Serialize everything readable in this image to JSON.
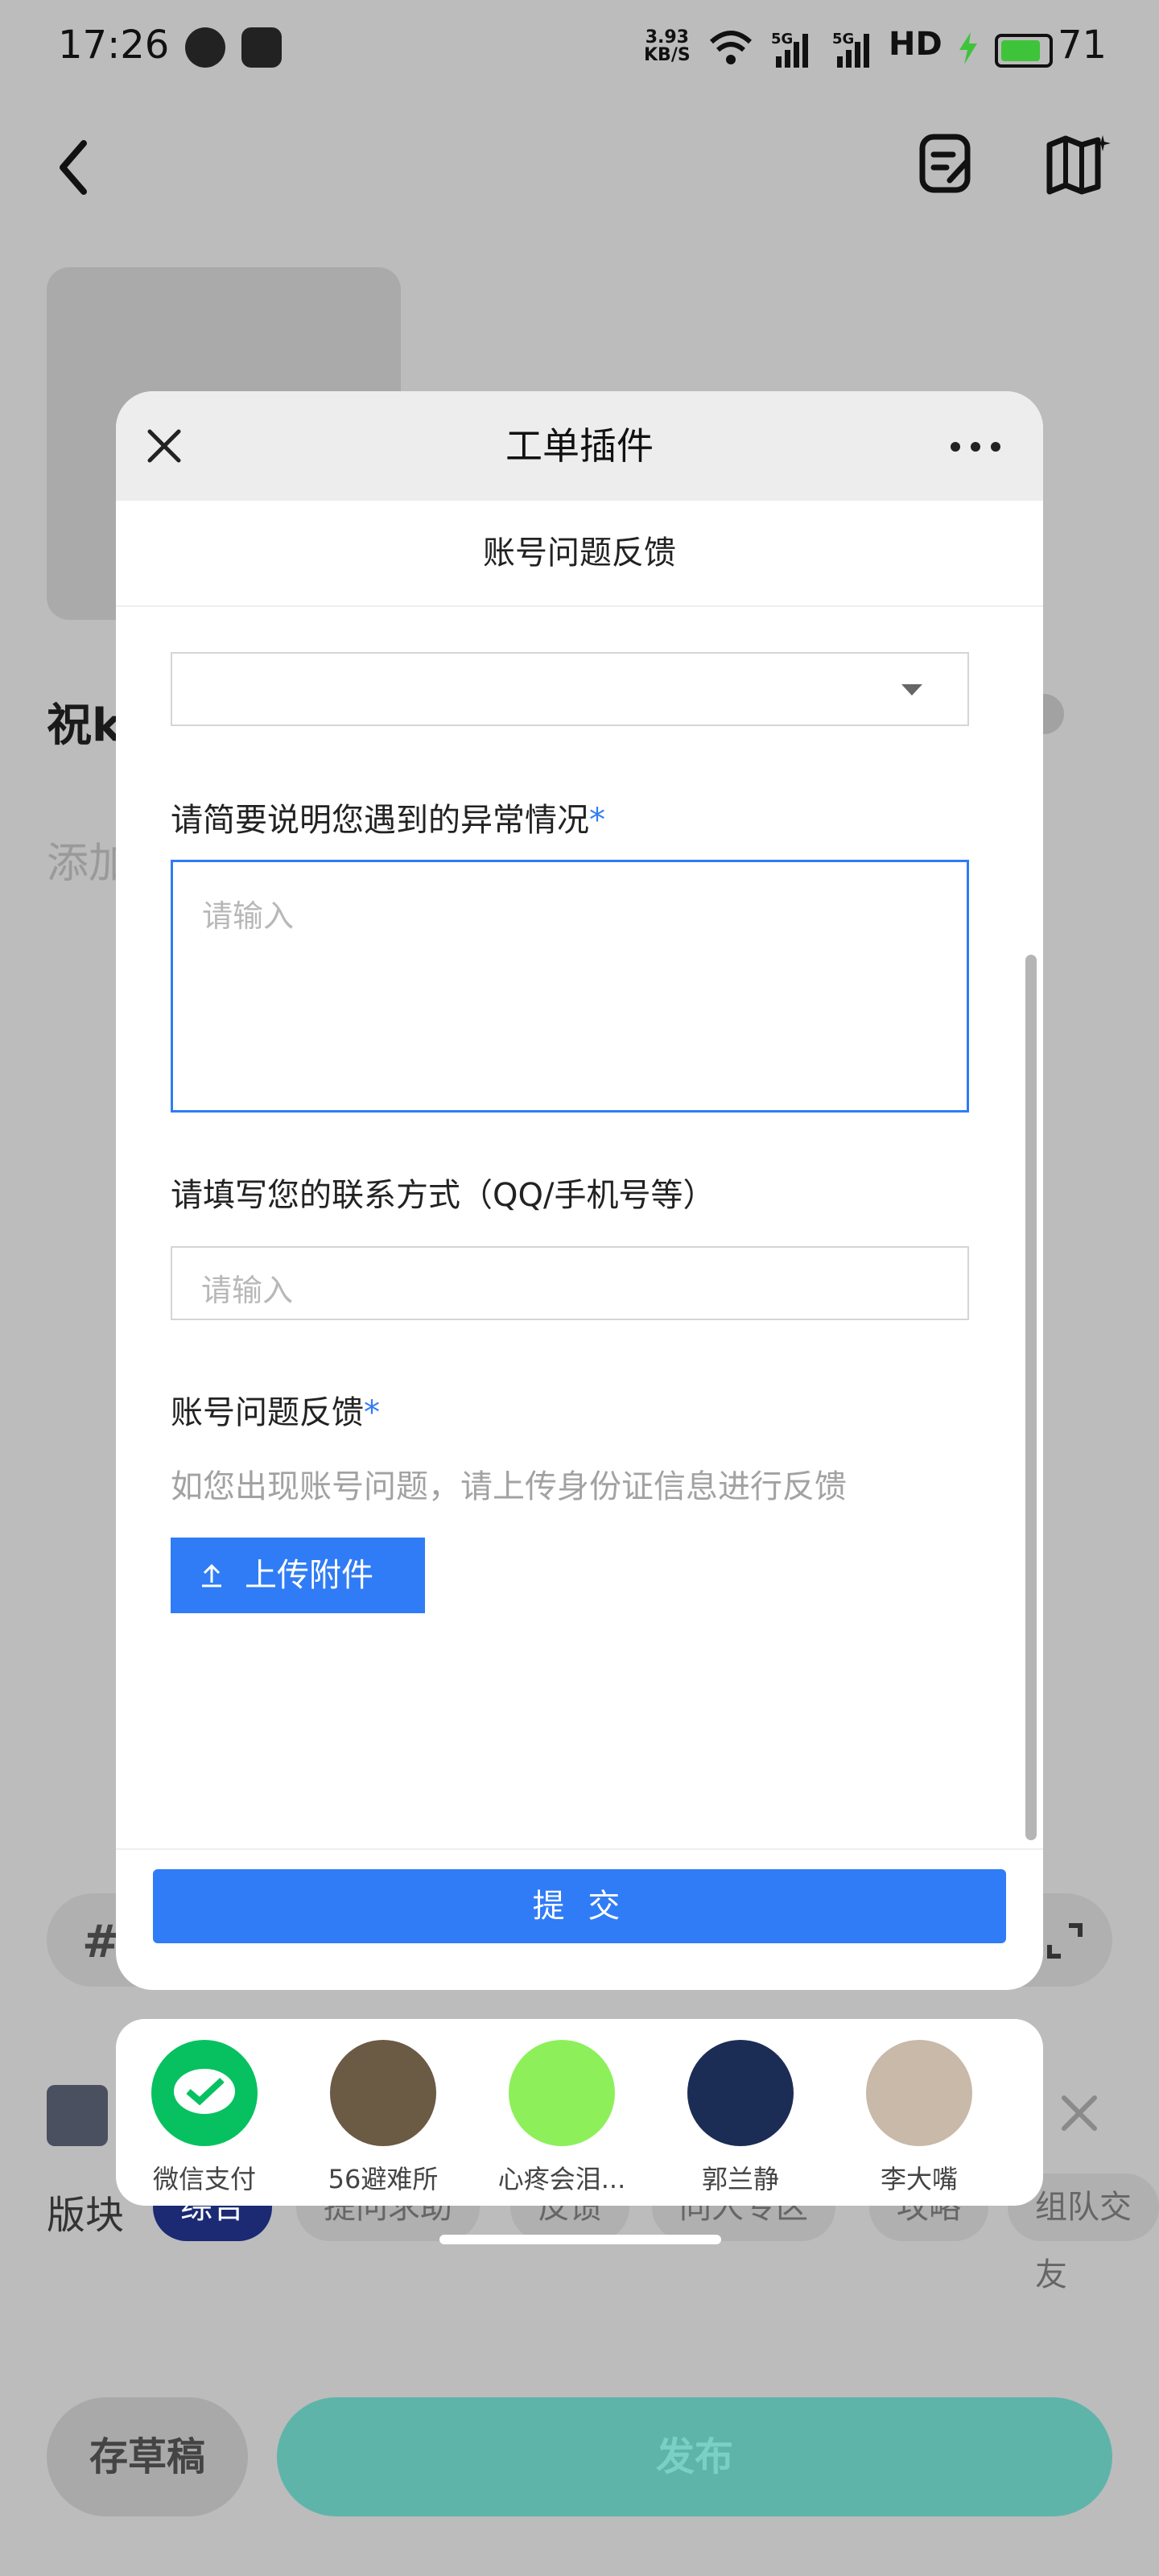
{
  "status_bar": {
    "time": "17:26",
    "speed_top": "3.93",
    "speed_bottom": "KB/S",
    "signal_1": "5G",
    "signal_2": "5G",
    "hd": "HD",
    "battery": "71"
  },
  "background": {
    "title_partial": "祝k",
    "add_partial": "添加",
    "hash": "#",
    "board_label": "版块",
    "chips": [
      "综合",
      "提问求助",
      "反馈",
      "同人专区",
      "攻略",
      "组队交友"
    ],
    "draft_button": "存草稿",
    "publish_button": "发布"
  },
  "dialog": {
    "title": "工单插件",
    "subtitle": "账号问题反馈",
    "anomaly_label": "请简要说明您遇到的异常情况",
    "required_mark": "*",
    "anomaly_placeholder": "请输入",
    "contact_label": "请填写您的联系方式（QQ/手机号等）",
    "contact_placeholder": "请输入",
    "account_label": "账号问题反馈",
    "account_hint": "如您出现账号问题，请上传身份证信息进行反馈",
    "upload_button": "上传附件",
    "submit_button": "提 交"
  },
  "share": {
    "items": [
      {
        "name": "微信支付",
        "color": "#07c160"
      },
      {
        "name": "56避难所",
        "color": "#6b5a44"
      },
      {
        "name": "心疼会泪...",
        "color": "#8df05a"
      },
      {
        "name": "郭兰静",
        "color": "#1c2d55"
      },
      {
        "name": "李大嘴",
        "color": "#c9b9a9"
      }
    ]
  },
  "colors": {
    "accent": "#2f7cf6",
    "publish": "#5fb4aa",
    "chip_active": "#1c2a74"
  }
}
